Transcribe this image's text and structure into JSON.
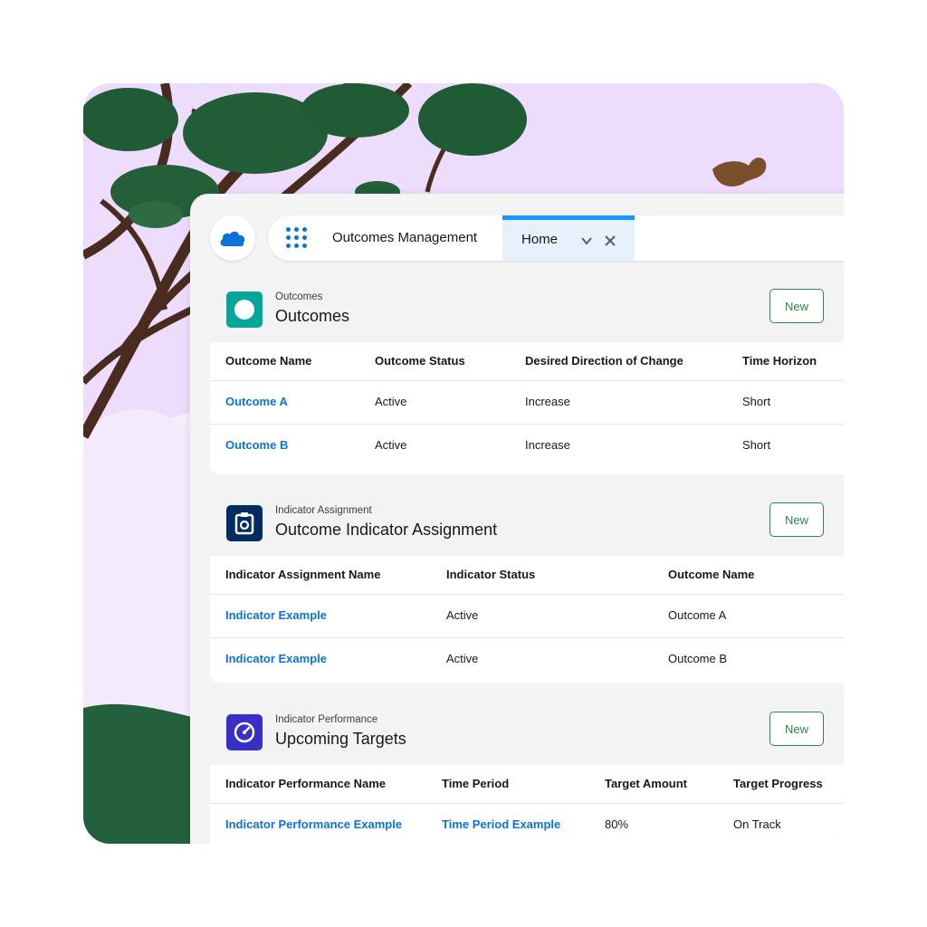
{
  "nav": {
    "app_name": "Outcomes Management",
    "tab_label": "Home"
  },
  "cards": [
    {
      "subtitle": "Outcomes",
      "title": "Outcomes",
      "new_label": "New",
      "icon": "outcome-circle-icon",
      "icon_color": "#06a59a",
      "columns": [
        "Outcome Name",
        "Outcome Status",
        "Desired Direction of Change",
        "Time Horizon"
      ],
      "rows": [
        [
          "Outcome A",
          "Active",
          "Increase",
          "Short"
        ],
        [
          "Outcome B",
          "Active",
          "Increase",
          "Short"
        ]
      ]
    },
    {
      "subtitle": "Indicator Assignment",
      "title": "Outcome Indicator Assignment",
      "new_label": "New",
      "icon": "clipboard-icon",
      "icon_color": "#032d60",
      "columns": [
        "Indicator Assignment Name",
        "Indicator Status",
        "Outcome Name"
      ],
      "rows": [
        [
          "Indicator Example",
          "Active",
          "Outcome A"
        ],
        [
          "Indicator Example",
          "Active",
          "Outcome B"
        ]
      ]
    },
    {
      "subtitle": "Indicator Performance",
      "title": "Upcoming Targets",
      "new_label": "New",
      "icon": "gauge-icon",
      "icon_color": "#3a2ec9",
      "columns": [
        "Indicator Performance Name",
        "Time Period",
        "Target Amount",
        "Target Progress"
      ],
      "rows": [
        [
          "Indicator Performance Example",
          "Time Period Example",
          "80%",
          "On Track"
        ]
      ]
    }
  ],
  "colors": {
    "brand_blue": "#0b72d9",
    "active_tab": "#1b96ff",
    "success_green": "#2e844a",
    "background_lavender": "#eddcfb"
  }
}
